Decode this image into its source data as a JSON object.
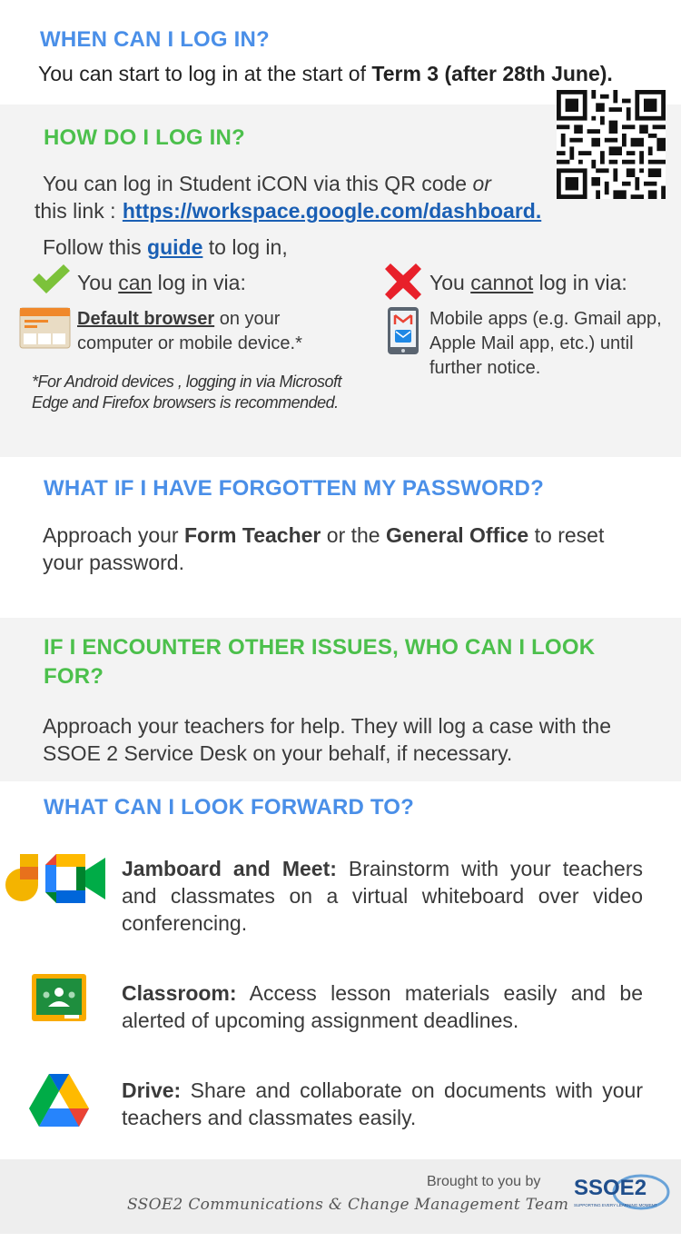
{
  "when": {
    "heading": "WHEN CAN I LOG IN?",
    "text_a": "You can start to log in at the start of ",
    "text_b": "Term 3 (after 28th June)."
  },
  "how": {
    "heading": "HOW DO I LOG IN?",
    "line1_a": "You can log in Student iCON via this QR code ",
    "line1_or": "or",
    "line1_b": " this link : ",
    "link": "https://workspace.google.com/dashboard.",
    "follow_a": "Follow this ",
    "follow_guide": "guide",
    "follow_b": " to log in,",
    "can": {
      "pre": "You ",
      "word": "can",
      "post": " log in via:",
      "item_bold": "Default browser",
      "item_rest": " on your computer or mobile device.*"
    },
    "cannot": {
      "pre": "You ",
      "word": "cannot",
      "post": " log in via:",
      "item": "Mobile apps (e.g. Gmail app, Apple Mail app, etc.) until further notice."
    },
    "footnote": "*For Android devices , logging in via Microsoft Edge and Firefox browsers is recommended."
  },
  "forgot": {
    "heading": "WHAT IF I HAVE FORGOTTEN MY PASSWORD?",
    "t1": "Approach your ",
    "b1": "Form Teacher",
    "t2": " or the ",
    "b2": "General Office",
    "t3": " to reset your password."
  },
  "issues": {
    "heading": "IF I ENCOUNTER OTHER ISSUES, WHO CAN I LOOK FOR?",
    "text": "Approach your teachers for help. They will log a case with the SSOE 2 Service Desk on your behalf, if necessary."
  },
  "forward": {
    "heading": "WHAT CAN I LOOK FORWARD TO?",
    "items": [
      {
        "bold": "Jamboard and Meet:",
        "text": " Brainstorm with your teachers and  classmates on a virtual whiteboard over video conferencing."
      },
      {
        "bold": "Classroom:",
        "text": " Access lesson materials easily and be alerted of upcoming assignment deadlines."
      },
      {
        "bold": "Drive:",
        "text": " Share and collaborate on documents with your teachers and classmates easily."
      }
    ]
  },
  "footer": {
    "brought": "Brought to you by",
    "team": "SSOE2 Communications & Change Management Team",
    "logo_text": "SSOE2",
    "logo_tag": "SUPPORTING EVERY LEARNING MOMENT"
  },
  "colors": {
    "heading_blue": "#4a8fe8",
    "heading_green": "#4cc04c",
    "link": "#1a5fb4",
    "panel": "#f3f3f3"
  }
}
